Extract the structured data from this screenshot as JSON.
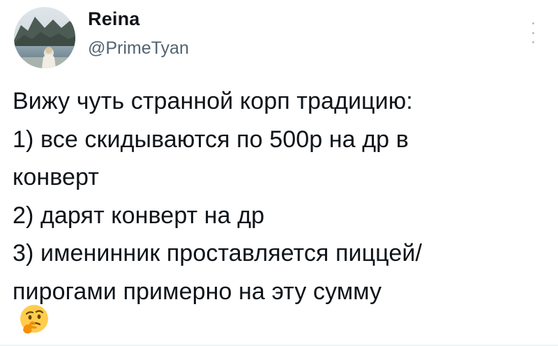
{
  "tweet": {
    "author_name": "Reina",
    "author_handle": "@PrimeTyan",
    "lines": [
      "Вижу чуть странной корп традицию:",
      "1) все скидываются по 500р на др в",
      "конверт",
      "2) дарят конверт на др",
      "3) именинник проставляется пиццей/",
      "пирогами примерно на эту сумму"
    ],
    "emoji_icon": "thinking-face-emoji"
  },
  "colors": {
    "text": "#0f1419",
    "secondary": "#536471",
    "background": "#ffffff",
    "more_dots": "#b7bdc2"
  },
  "icons": {
    "more": "more-options-icon",
    "avatar": "profile-photo-mountain-lake"
  }
}
